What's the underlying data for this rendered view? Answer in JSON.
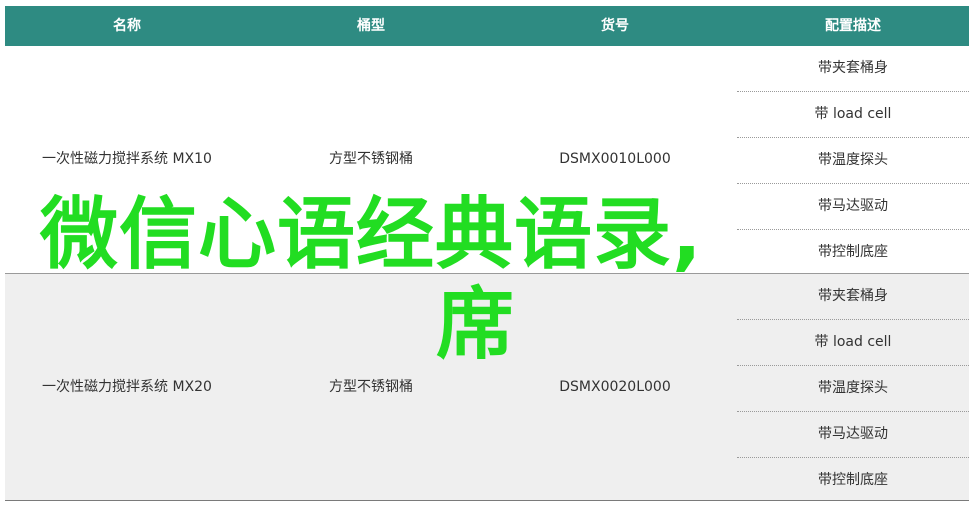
{
  "table": {
    "headers": {
      "name": "名称",
      "type": "桶型",
      "sku": "货号",
      "config": "配置描述"
    },
    "rows": [
      {
        "name": "一次性磁力搅拌系统 MX10",
        "type": "方型不锈钢桶",
        "sku": "DSMX0010L000",
        "config": [
          "带夹套桶身",
          "带 load cell",
          "带温度探头",
          "带马达驱动",
          "带控制底座"
        ]
      },
      {
        "name": "一次性磁力搅拌系统 MX20",
        "type": "方型不锈钢桶",
        "sku": "DSMX0020L000",
        "config": [
          "带夹套桶身",
          "带 load cell",
          "带温度探头",
          "带马达驱动",
          "带控制底座"
        ]
      }
    ]
  },
  "overlay": {
    "line1": "微信心语经典语录,",
    "line2": "席"
  },
  "colors": {
    "header_bg": "#2e8b82",
    "alt_row_bg": "#efefef",
    "overlay_text": "#22dd22"
  }
}
